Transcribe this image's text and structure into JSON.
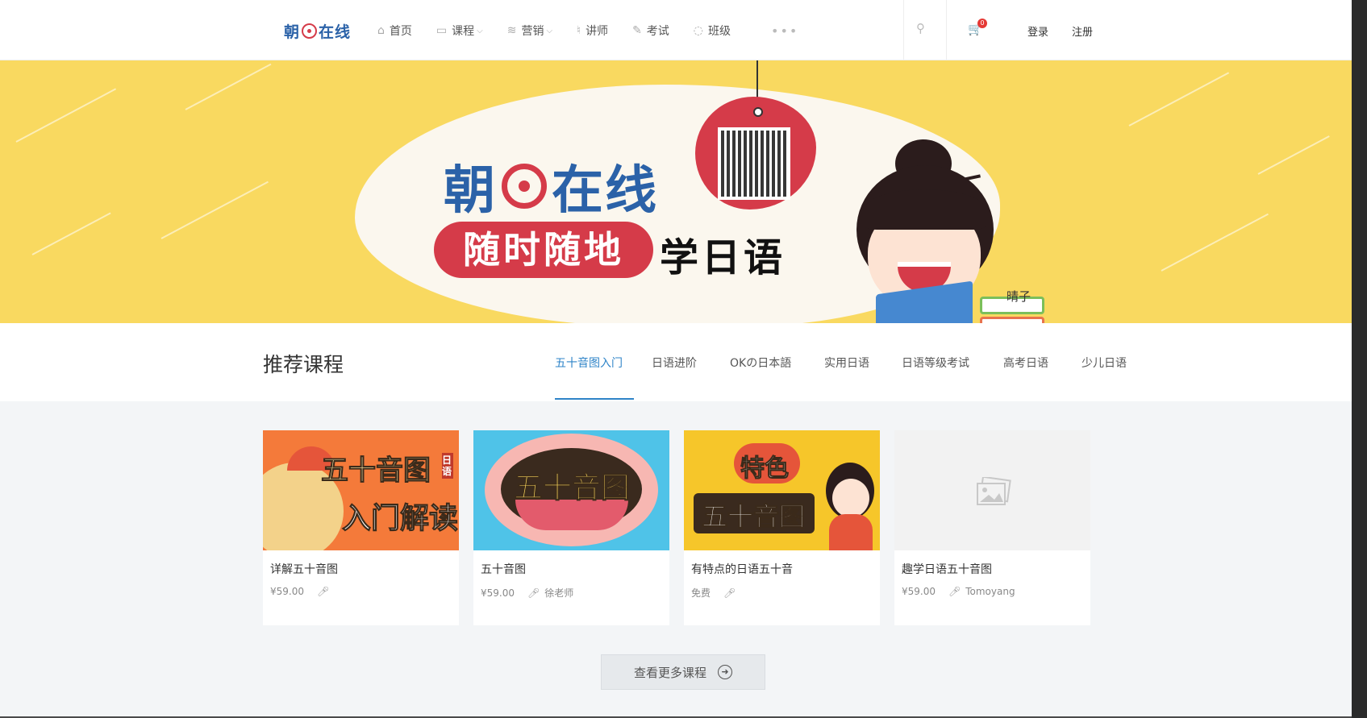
{
  "header": {
    "logo": {
      "part1": "朝",
      "part2": "在线"
    },
    "nav": [
      {
        "label": "首页",
        "icon": "home-icon",
        "glyph": "⌂",
        "dropdown": false
      },
      {
        "label": "课程",
        "icon": "book-icon",
        "glyph": "▭",
        "dropdown": true
      },
      {
        "label": "营销",
        "icon": "layers-icon",
        "glyph": "≋",
        "dropdown": true
      },
      {
        "label": "讲师",
        "icon": "mic-icon",
        "glyph": "♮",
        "dropdown": false
      },
      {
        "label": "考试",
        "icon": "pencil-icon",
        "glyph": "✎",
        "dropdown": false
      },
      {
        "label": "班级",
        "icon": "chat-icon",
        "glyph": "◌",
        "dropdown": false
      }
    ],
    "more": "•••",
    "cart_count": "0",
    "login": "登录",
    "register": "注册"
  },
  "banner": {
    "brand_part1": "朝",
    "brand_part2": "在线",
    "tagline_pill": "随时随地",
    "tagline_text": "学日语",
    "character_name": "晴子",
    "colors": {
      "background": "#f9d960",
      "accent": "#d53b49",
      "brand": "#2b62a8"
    }
  },
  "recommended": {
    "title": "推荐课程",
    "tabs": [
      "五十音图入门",
      "日语进阶",
      "OKの日本語",
      "实用日语",
      "日语等级考试",
      "高考日语",
      "少儿日语"
    ],
    "active_tab": "五十音图入门"
  },
  "courses": [
    {
      "title": "详解五十音图",
      "price": "¥59.00",
      "teacher": "",
      "thumb_line1": "五十音图",
      "thumb_line2": "入门解读",
      "thumb_tag": "日语"
    },
    {
      "title": "五十音图",
      "price": "¥59.00",
      "teacher": "徐老师",
      "thumb_line1": "五十音图"
    },
    {
      "title": "有特点的日语五十音",
      "price": "免费",
      "teacher": "",
      "thumb_line1": "特色",
      "thumb_line2": "五十音图"
    },
    {
      "title": "趣学日语五十音图",
      "price": "¥59.00",
      "teacher": "Tomoyang"
    }
  ],
  "more_button": "查看更多课程"
}
